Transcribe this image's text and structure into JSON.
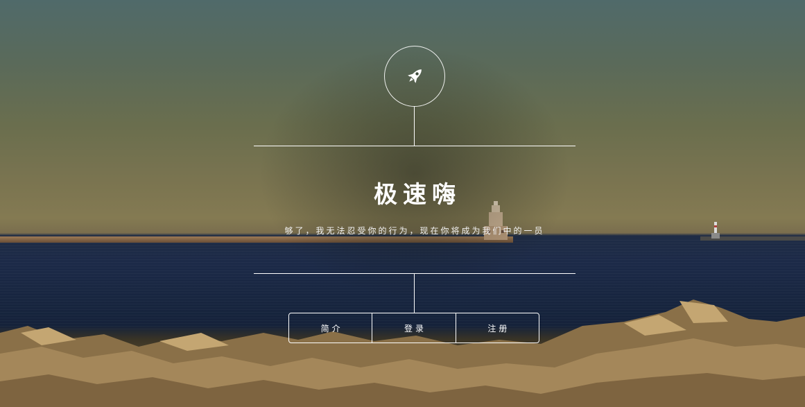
{
  "header": {
    "logo_icon": "rocket-icon",
    "title": "极速嗨",
    "tagline": "够了，我无法忍受你的行为，现在你将成为我们中的一员"
  },
  "nav": {
    "items": [
      {
        "label": "简介"
      },
      {
        "label": "登录"
      },
      {
        "label": "注册"
      }
    ]
  },
  "colors": {
    "foreground": "#ffffff",
    "sky": "#506a6a",
    "sea": "#1c2a48"
  }
}
